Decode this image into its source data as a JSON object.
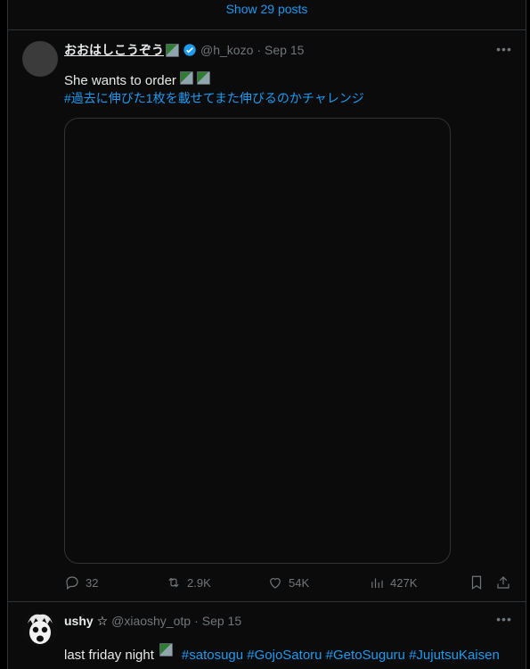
{
  "show_posts": {
    "label": "Show 29 posts"
  },
  "tweet1": {
    "name": "おおはしこうぞう",
    "handle": "@h_kozo",
    "separator": "·",
    "date": "Sep 15",
    "text": "She wants to order",
    "hashtag_line": "#過去に伸びた1枚を載せてまた伸びるのかチャレンジ",
    "actions": {
      "replies": "32",
      "reposts": "2.9K",
      "likes": "54K",
      "views": "427K"
    }
  },
  "tweet2": {
    "name": "ushy ☆",
    "handle": "@xiaoshy_otp",
    "separator": "·",
    "date": "Sep 15",
    "text": "last friday night",
    "hashtags": "#satosugu #GojoSatoru #GetoSuguru #JujutsuKaisen"
  },
  "colors": {
    "accent": "#1d9bf0",
    "muted": "#71767b",
    "background": "#000000"
  },
  "icons": [
    "verified-badge-icon",
    "more-icon",
    "reply-icon",
    "repost-icon",
    "like-icon",
    "views-icon",
    "bookmark-icon",
    "share-icon"
  ]
}
